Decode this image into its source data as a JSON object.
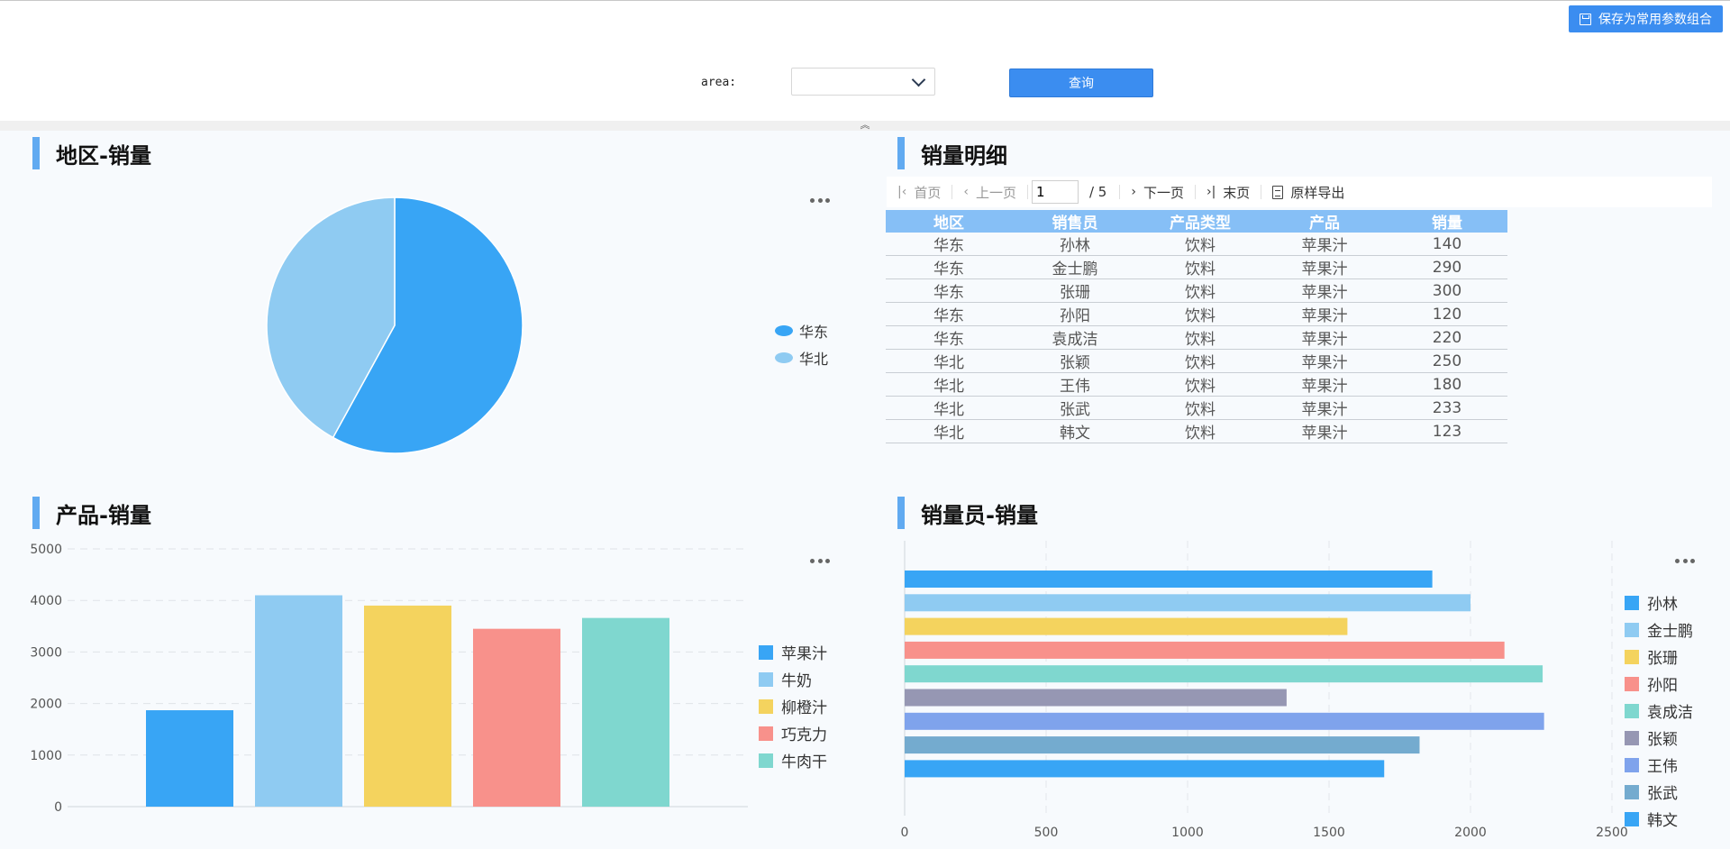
{
  "toolbar": {
    "save_label": "保存为常用参数组合",
    "area_label": "area:",
    "area_value": "",
    "query_label": "查询",
    "collapse_glyph": "︽"
  },
  "panels": {
    "pie_title": "地区-销量",
    "detail_title": "销量明细",
    "product_title": "产品-销量",
    "seller_title": "销量员-销量"
  },
  "pager": {
    "first": "首页",
    "prev": "上一页",
    "page": "1",
    "total": "/ 5",
    "next": "下一页",
    "last": "末页",
    "export": "原样导出"
  },
  "table": {
    "headers": [
      "地区",
      "销售员",
      "产品类型",
      "产品",
      "销量"
    ],
    "rows": [
      [
        "华东",
        "孙林",
        "饮料",
        "苹果汁",
        "140"
      ],
      [
        "华东",
        "金士鹏",
        "饮料",
        "苹果汁",
        "290"
      ],
      [
        "华东",
        "张珊",
        "饮料",
        "苹果汁",
        "300"
      ],
      [
        "华东",
        "孙阳",
        "饮料",
        "苹果汁",
        "120"
      ],
      [
        "华东",
        "袁成洁",
        "饮料",
        "苹果汁",
        "220"
      ],
      [
        "华北",
        "张颖",
        "饮料",
        "苹果汁",
        "250"
      ],
      [
        "华北",
        "王伟",
        "饮料",
        "苹果汁",
        "180"
      ],
      [
        "华北",
        "张武",
        "饮料",
        "苹果汁",
        "233"
      ],
      [
        "华北",
        "韩文",
        "饮料",
        "苹果汁",
        "123"
      ]
    ]
  },
  "colors": {
    "accent": "#3b8df0",
    "title_bar": "#61aaf1",
    "table_header": "#86bff6"
  },
  "chart_data": [
    {
      "type": "pie",
      "title": "地区-销量",
      "categories": [
        "华东",
        "华北"
      ],
      "values": [
        58,
        42
      ],
      "colors": [
        "#38a5f5",
        "#8fcbf2"
      ],
      "legend": "right"
    },
    {
      "type": "bar",
      "title": "产品-销量",
      "categories": [
        "苹果汁",
        "牛奶",
        "柳橙汁",
        "巧克力",
        "牛肉干"
      ],
      "values": [
        1870,
        4100,
        3900,
        3450,
        3660
      ],
      "colors": [
        "#38a5f5",
        "#8fcbf2",
        "#f4d35e",
        "#f8918b",
        "#7fd7cf"
      ],
      "ylim": [
        0,
        5000
      ],
      "yticks": [
        0,
        1000,
        2000,
        3000,
        4000,
        5000
      ],
      "grid": true,
      "legend": "right"
    },
    {
      "type": "bar",
      "orientation": "horizontal",
      "title": "销量员-销量",
      "categories": [
        "孙林",
        "金士鹏",
        "张珊",
        "孙阳",
        "袁成洁",
        "张颖",
        "王伟",
        "张武",
        "韩文"
      ],
      "values": [
        1865,
        2000,
        1565,
        2120,
        2255,
        1350,
        2260,
        1820,
        1695
      ],
      "colors": [
        "#38a5f5",
        "#8fcbf2",
        "#f4d35e",
        "#f8918b",
        "#7fd7cf",
        "#9697b3",
        "#7fa3ec",
        "#74abcf",
        "#38a5f5"
      ],
      "xlim": [
        0,
        2500
      ],
      "xticks": [
        0,
        500,
        1000,
        1500,
        2000,
        2500
      ],
      "grid": true,
      "legend": "right"
    }
  ]
}
